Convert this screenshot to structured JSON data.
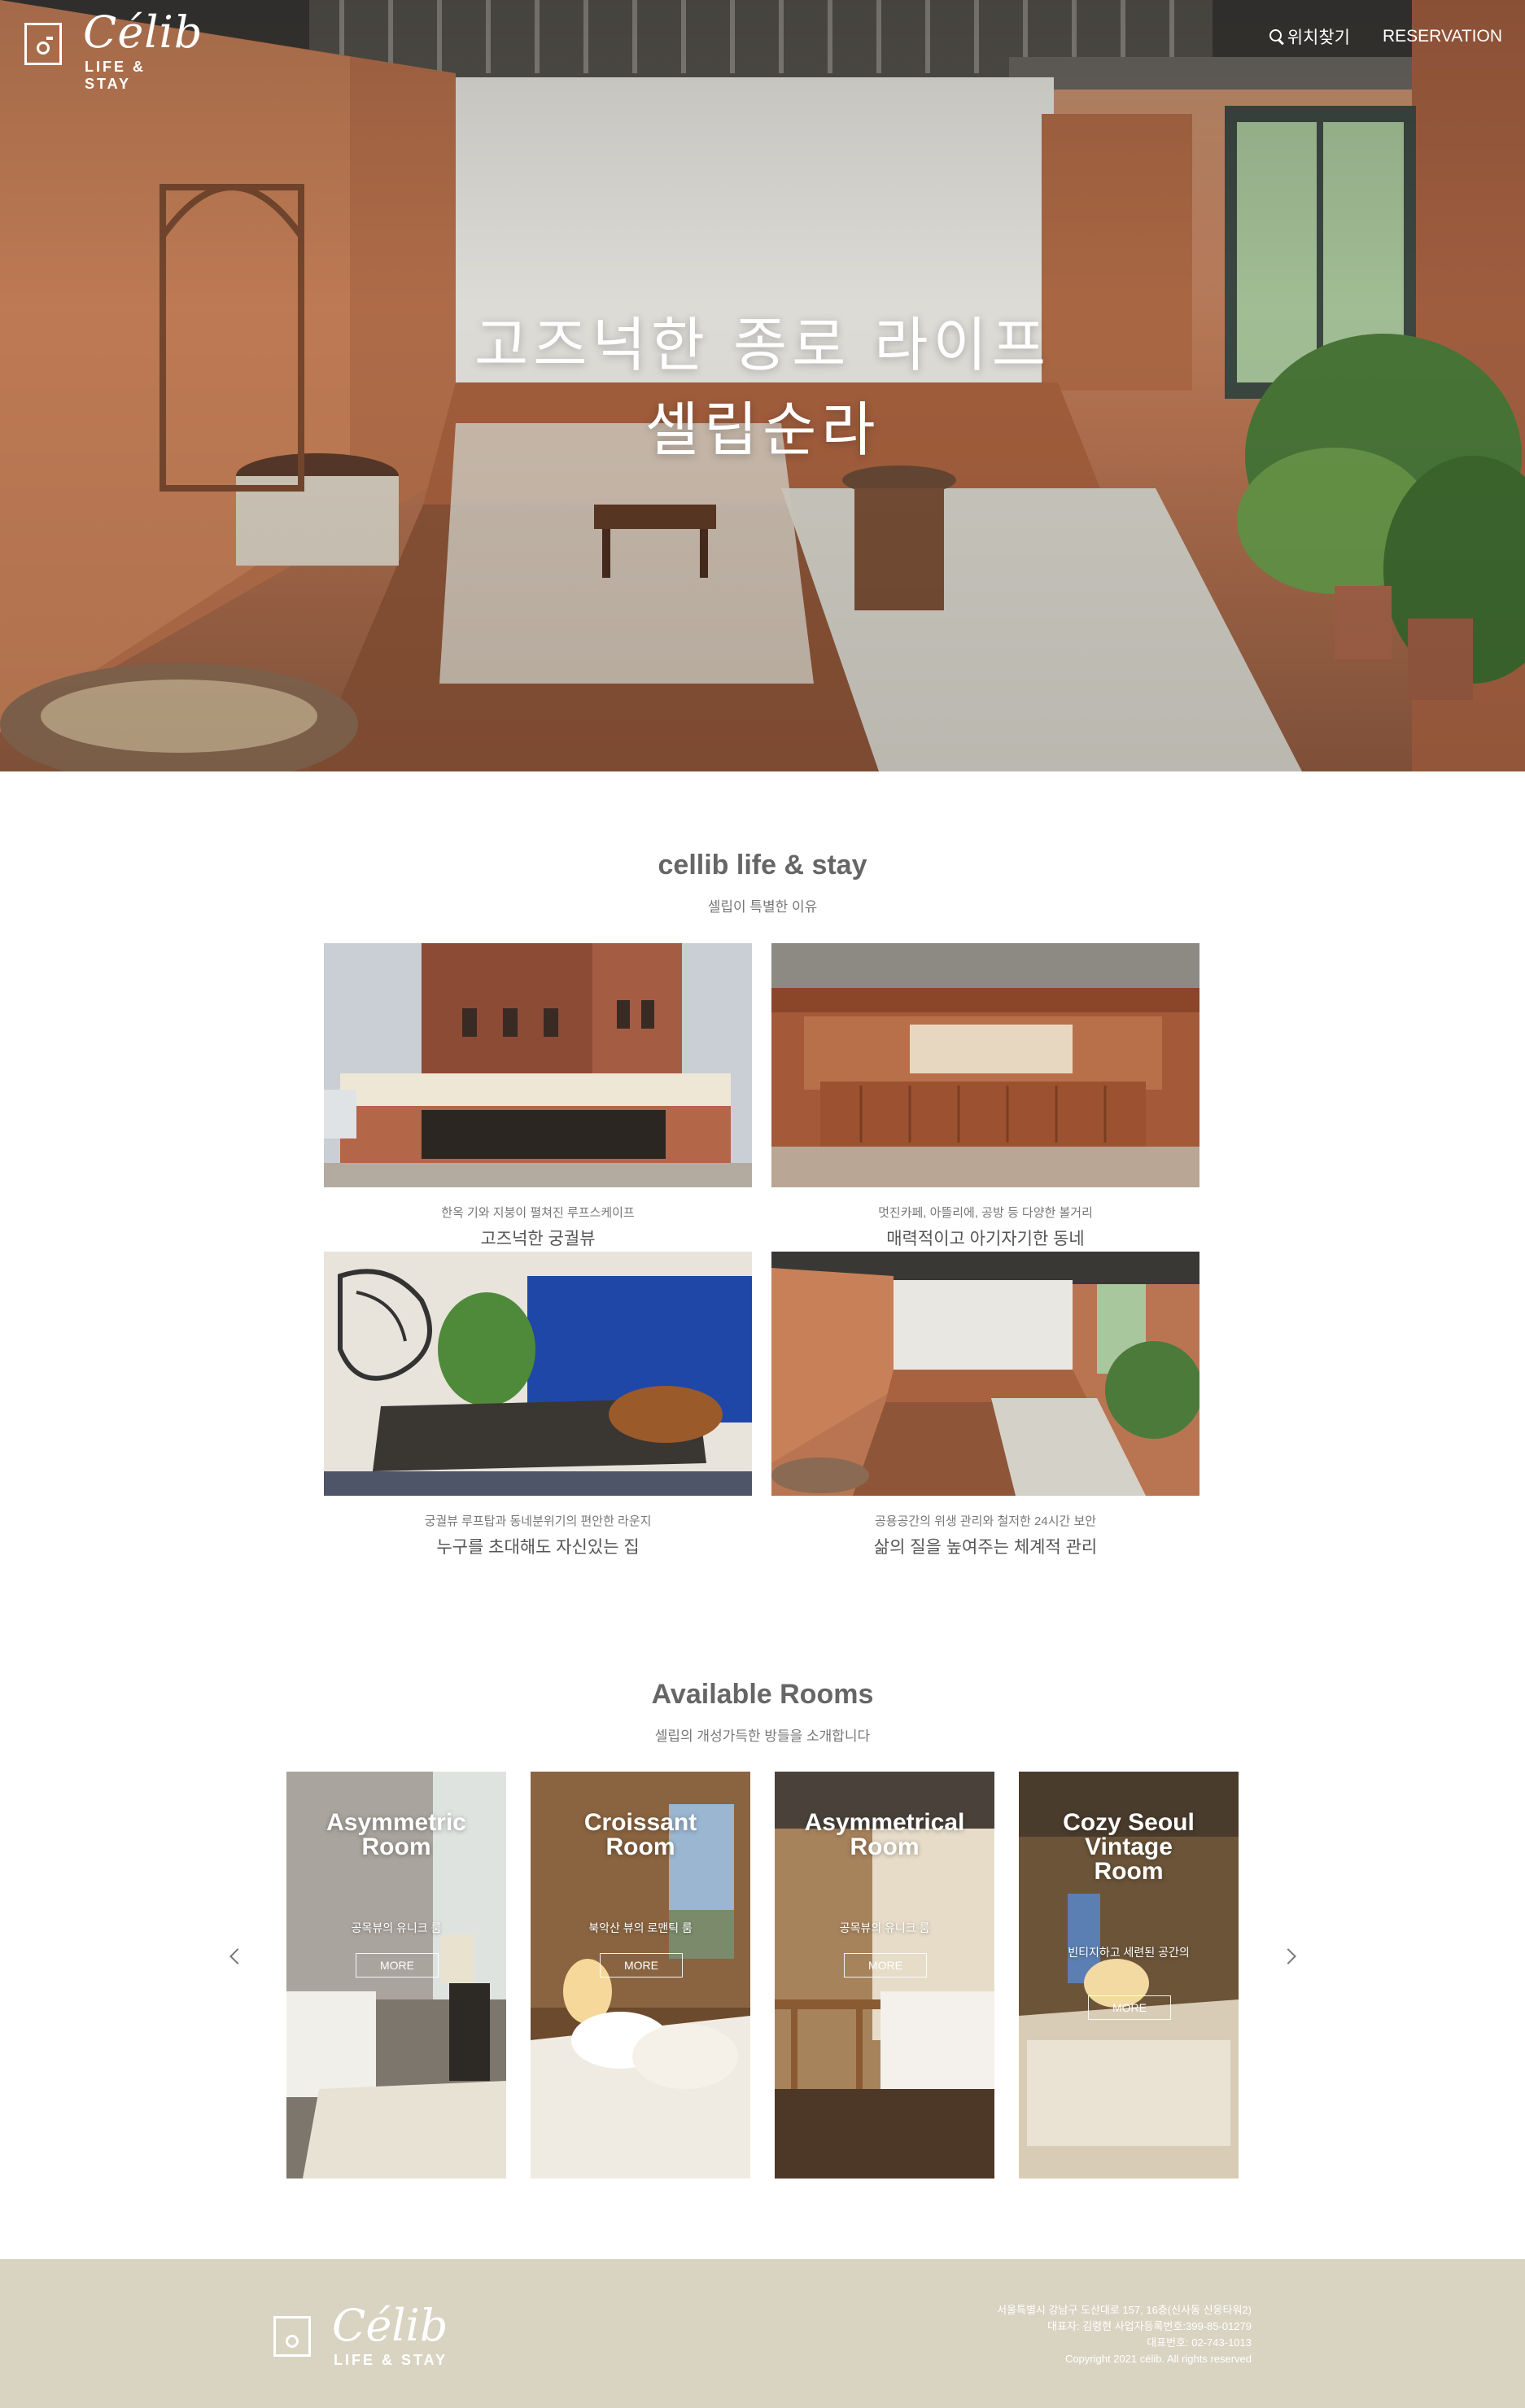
{
  "brand": {
    "logo_word": "Célib",
    "logo_sub": "LIFE & STAY"
  },
  "nav": {
    "location_label": "위치찾기",
    "reservation_label": "RESERVATION"
  },
  "hero": {
    "line1": "고즈넉한 종로 라이프",
    "line2": "셀립순라"
  },
  "about": {
    "title": "cellib life & stay",
    "subtitle": "셀립이 특별한 이유",
    "features": [
      {
        "small": "한옥 기와 지붕이 펼쳐진 루프스케이프",
        "big": "고즈넉한 궁궐뷰"
      },
      {
        "small": "멋진카페, 아뜰리에, 공방 등 다양한 볼거리",
        "big": "매력적이고 아기자기한 동네"
      },
      {
        "small": "궁궐뷰 루프탑과 동네분위기의 편안한 라운지",
        "big": "누구를 초대해도 자신있는 집"
      },
      {
        "small": "공용공간의 위생 관리와 철저한 24시간 보안",
        "big": "삶의 질을 높여주는 체계적 관리"
      }
    ]
  },
  "rooms": {
    "title": "Available Rooms",
    "subtitle": "셀립의 개성가득한 방들을 소개합니다",
    "items": [
      {
        "name_line1": "Asymmetric",
        "name_line2": "Room",
        "name_line3": "",
        "desc": "공목뷰의 유니크 룸",
        "more": "MORE"
      },
      {
        "name_line1": "Croissant",
        "name_line2": "Room",
        "name_line3": "",
        "desc": "북악산 뷰의 로맨틱 룸",
        "more": "MORE"
      },
      {
        "name_line1": "Asymmetrical",
        "name_line2": "Room",
        "name_line3": "",
        "desc": "공목뷰의 유니크 룸",
        "more": "MORE"
      },
      {
        "name_line1": "Cozy Seoul",
        "name_line2": "Vintage",
        "name_line3": "Room",
        "desc": "빈티지하고 세련된 공간의",
        "more": "MORE"
      }
    ]
  },
  "footer": {
    "address": "서울특별시 강남구 도산대로 157, 16층(신사동 신웅타워2)",
    "ceo": "대표자: 김령현 사업자등록번호:399-85-01279",
    "phone": "대표번호: 02-743-1013",
    "copyright": "Copyright 2021 célib. All rights reserved"
  },
  "icons": [
    "search-icon",
    "chevron-left-icon",
    "chevron-right-icon"
  ],
  "colors": {
    "footer_bg": "#d9d3c2",
    "hero_wood": "#b97552",
    "text_gray": "#666666"
  }
}
